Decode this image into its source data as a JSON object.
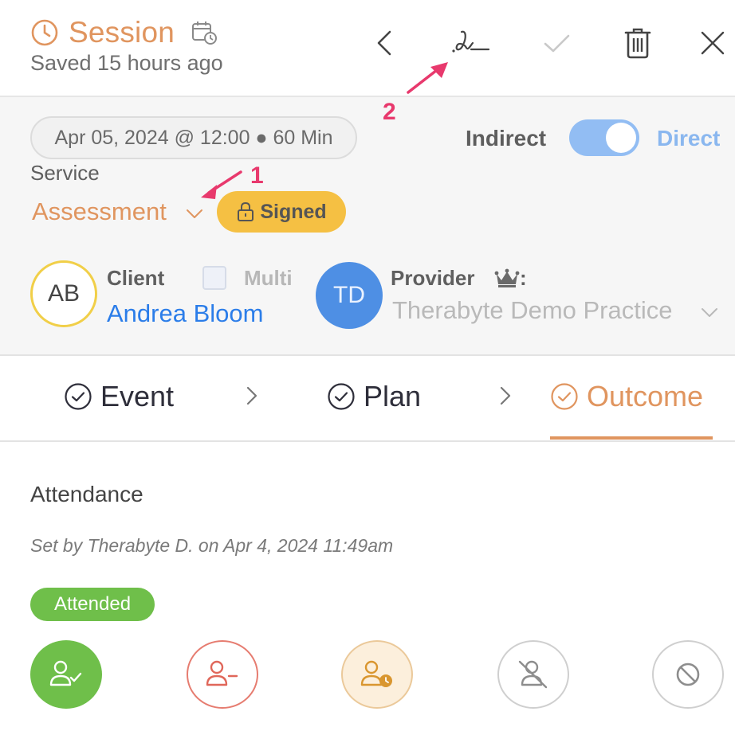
{
  "header": {
    "title": "Session",
    "saved_text": "Saved 15 hours ago",
    "icons": [
      "clock-icon",
      "calendar-clock-icon",
      "chevron-left-icon",
      "signature-icon",
      "checkmark-icon",
      "trash-icon",
      "close-icon"
    ]
  },
  "session": {
    "date_time": "Apr 05, 2024 @ 12:00 ● 60 Min",
    "mode_left": "Indirect",
    "mode_right": "Direct",
    "mode_selected": "Direct",
    "service_label": "Service",
    "service_value": "Assessment",
    "signed_label": "Signed",
    "client_label": "Client",
    "multi_label": "Multi",
    "multi_checked": false,
    "client_initials": "AB",
    "client_name": "Andrea Bloom",
    "provider_label": "Provider",
    "provider_suffix": ":",
    "provider_initials": "TD",
    "provider_name": "Therabyte Demo Practice"
  },
  "tabs": [
    {
      "label": "Event",
      "active": false
    },
    {
      "label": "Plan",
      "active": false
    },
    {
      "label": "Outcome",
      "active": true
    }
  ],
  "attendance": {
    "title": "Attendance",
    "set_by": "Set by Therabyte D. on Apr 4, 2024 11:49am",
    "status": "Attended",
    "options": [
      "attended-icon",
      "absent-icon",
      "late-icon",
      "no-show-icon",
      "cancelled-icon"
    ]
  },
  "annotations": {
    "marker_1": "1",
    "marker_2": "2"
  },
  "colors": {
    "accent": "#e0955f",
    "link_blue": "#2b7de9",
    "toggle_blue": "#92bdf3",
    "signed_yellow": "#f5c043",
    "attended_green": "#6fbf4a",
    "annotation_pink": "#e8396d"
  }
}
